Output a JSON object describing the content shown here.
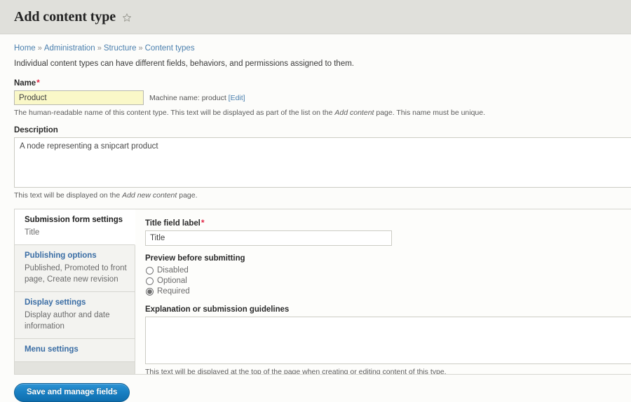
{
  "header": {
    "title": "Add content type",
    "star_icon": "star-outline-icon"
  },
  "breadcrumb": {
    "items": [
      "Home",
      "Administration",
      "Structure",
      "Content types"
    ],
    "separator": "»"
  },
  "intro": "Individual content types can have different fields, behaviors, and permissions assigned to them.",
  "name_field": {
    "label": "Name",
    "required_mark": "*",
    "value": "Product",
    "machine_name_prefix": "Machine name: ",
    "machine_name_value": "product",
    "machine_name_edit": "[Edit]",
    "description_pre": "The human-readable name of this content type. This text will be displayed as part of the list on the ",
    "description_em": "Add content",
    "description_post": " page. This name must be unique."
  },
  "description_field": {
    "label": "Description",
    "value": "A node representing a snipcart product",
    "help_pre": "This text will be displayed on the ",
    "help_em": "Add new content",
    "help_post": " page."
  },
  "vertical_tabs": [
    {
      "title": "Submission form settings",
      "summary": "Title",
      "active": true
    },
    {
      "title": "Publishing options",
      "summary": "Published, Promoted to front page, Create new revision",
      "active": false
    },
    {
      "title": "Display settings",
      "summary": "Display author and date information",
      "active": false
    },
    {
      "title": "Menu settings",
      "summary": "",
      "active": false
    }
  ],
  "pane": {
    "title_field_label": "Title field label",
    "title_field_required": "*",
    "title_field_value": "Title",
    "preview_label": "Preview before submitting",
    "preview_options": [
      {
        "label": "Disabled",
        "selected": false
      },
      {
        "label": "Optional",
        "selected": false
      },
      {
        "label": "Required",
        "selected": true
      }
    ],
    "explanation_label": "Explanation or submission guidelines",
    "explanation_value": "",
    "explanation_help": "This text will be displayed at the top of the page when creating or editing content of this type."
  },
  "actions": {
    "save_label": "Save and manage fields"
  },
  "colors": {
    "header_band": "#e0e0db",
    "link": "#4a7fae",
    "tab_link": "#3b6ea5",
    "required": "#e02443",
    "button": "#1a81c4",
    "input_autofill": "#faf8c8"
  }
}
